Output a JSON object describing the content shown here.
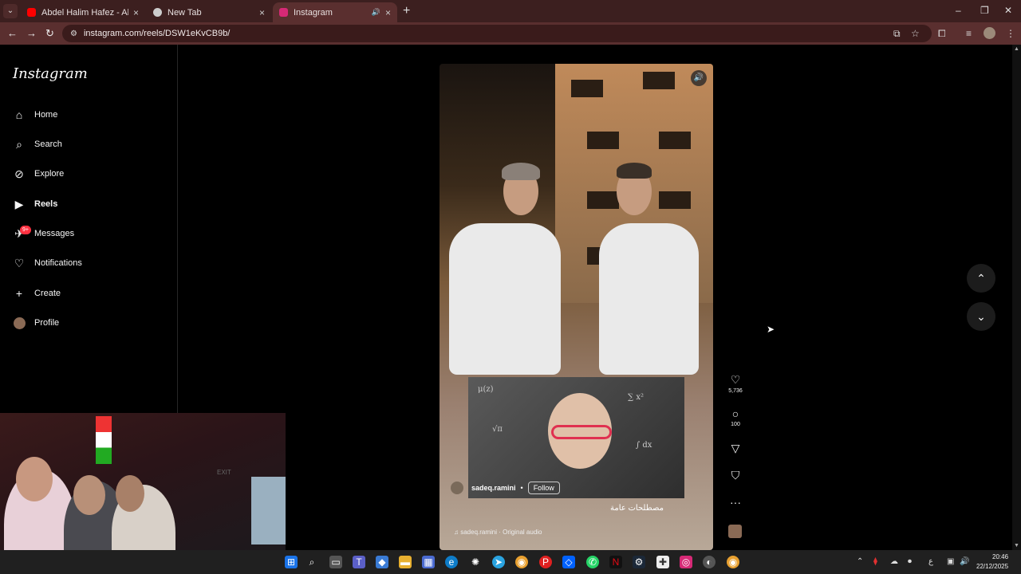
{
  "browser": {
    "tabs": [
      {
        "title": "Abdel Halim Hafez - Ala Hesb W",
        "favicon_color": "#ff0000"
      },
      {
        "title": "New Tab",
        "favicon_color": "#cccccc"
      },
      {
        "title": "Instagram",
        "favicon_color": "#d62976"
      }
    ],
    "url": "instagram.com/reels/DSW1eKvCB9b/"
  },
  "sidebar": {
    "logo": "Instagram",
    "items": [
      {
        "label": "Home",
        "icon": "home-icon"
      },
      {
        "label": "Search",
        "icon": "search-icon"
      },
      {
        "label": "Explore",
        "icon": "compass-icon"
      },
      {
        "label": "Reels",
        "icon": "reels-icon"
      },
      {
        "label": "Messages",
        "icon": "messenger-icon"
      },
      {
        "label": "Notifications",
        "icon": "heart-icon"
      },
      {
        "label": "Create",
        "icon": "plus-icon"
      },
      {
        "label": "Profile",
        "icon": "avatar"
      }
    ],
    "messages_badge": "9+"
  },
  "reel": {
    "username": "sadeq.ramini",
    "follow_label": "Follow",
    "caption": "مصطلحات عامة",
    "audio": "sadeq.ramini · Original audio",
    "likes": "5,736",
    "comments": "100"
  },
  "taskbar": {
    "time": "20:46",
    "date": "22/12/2025"
  }
}
